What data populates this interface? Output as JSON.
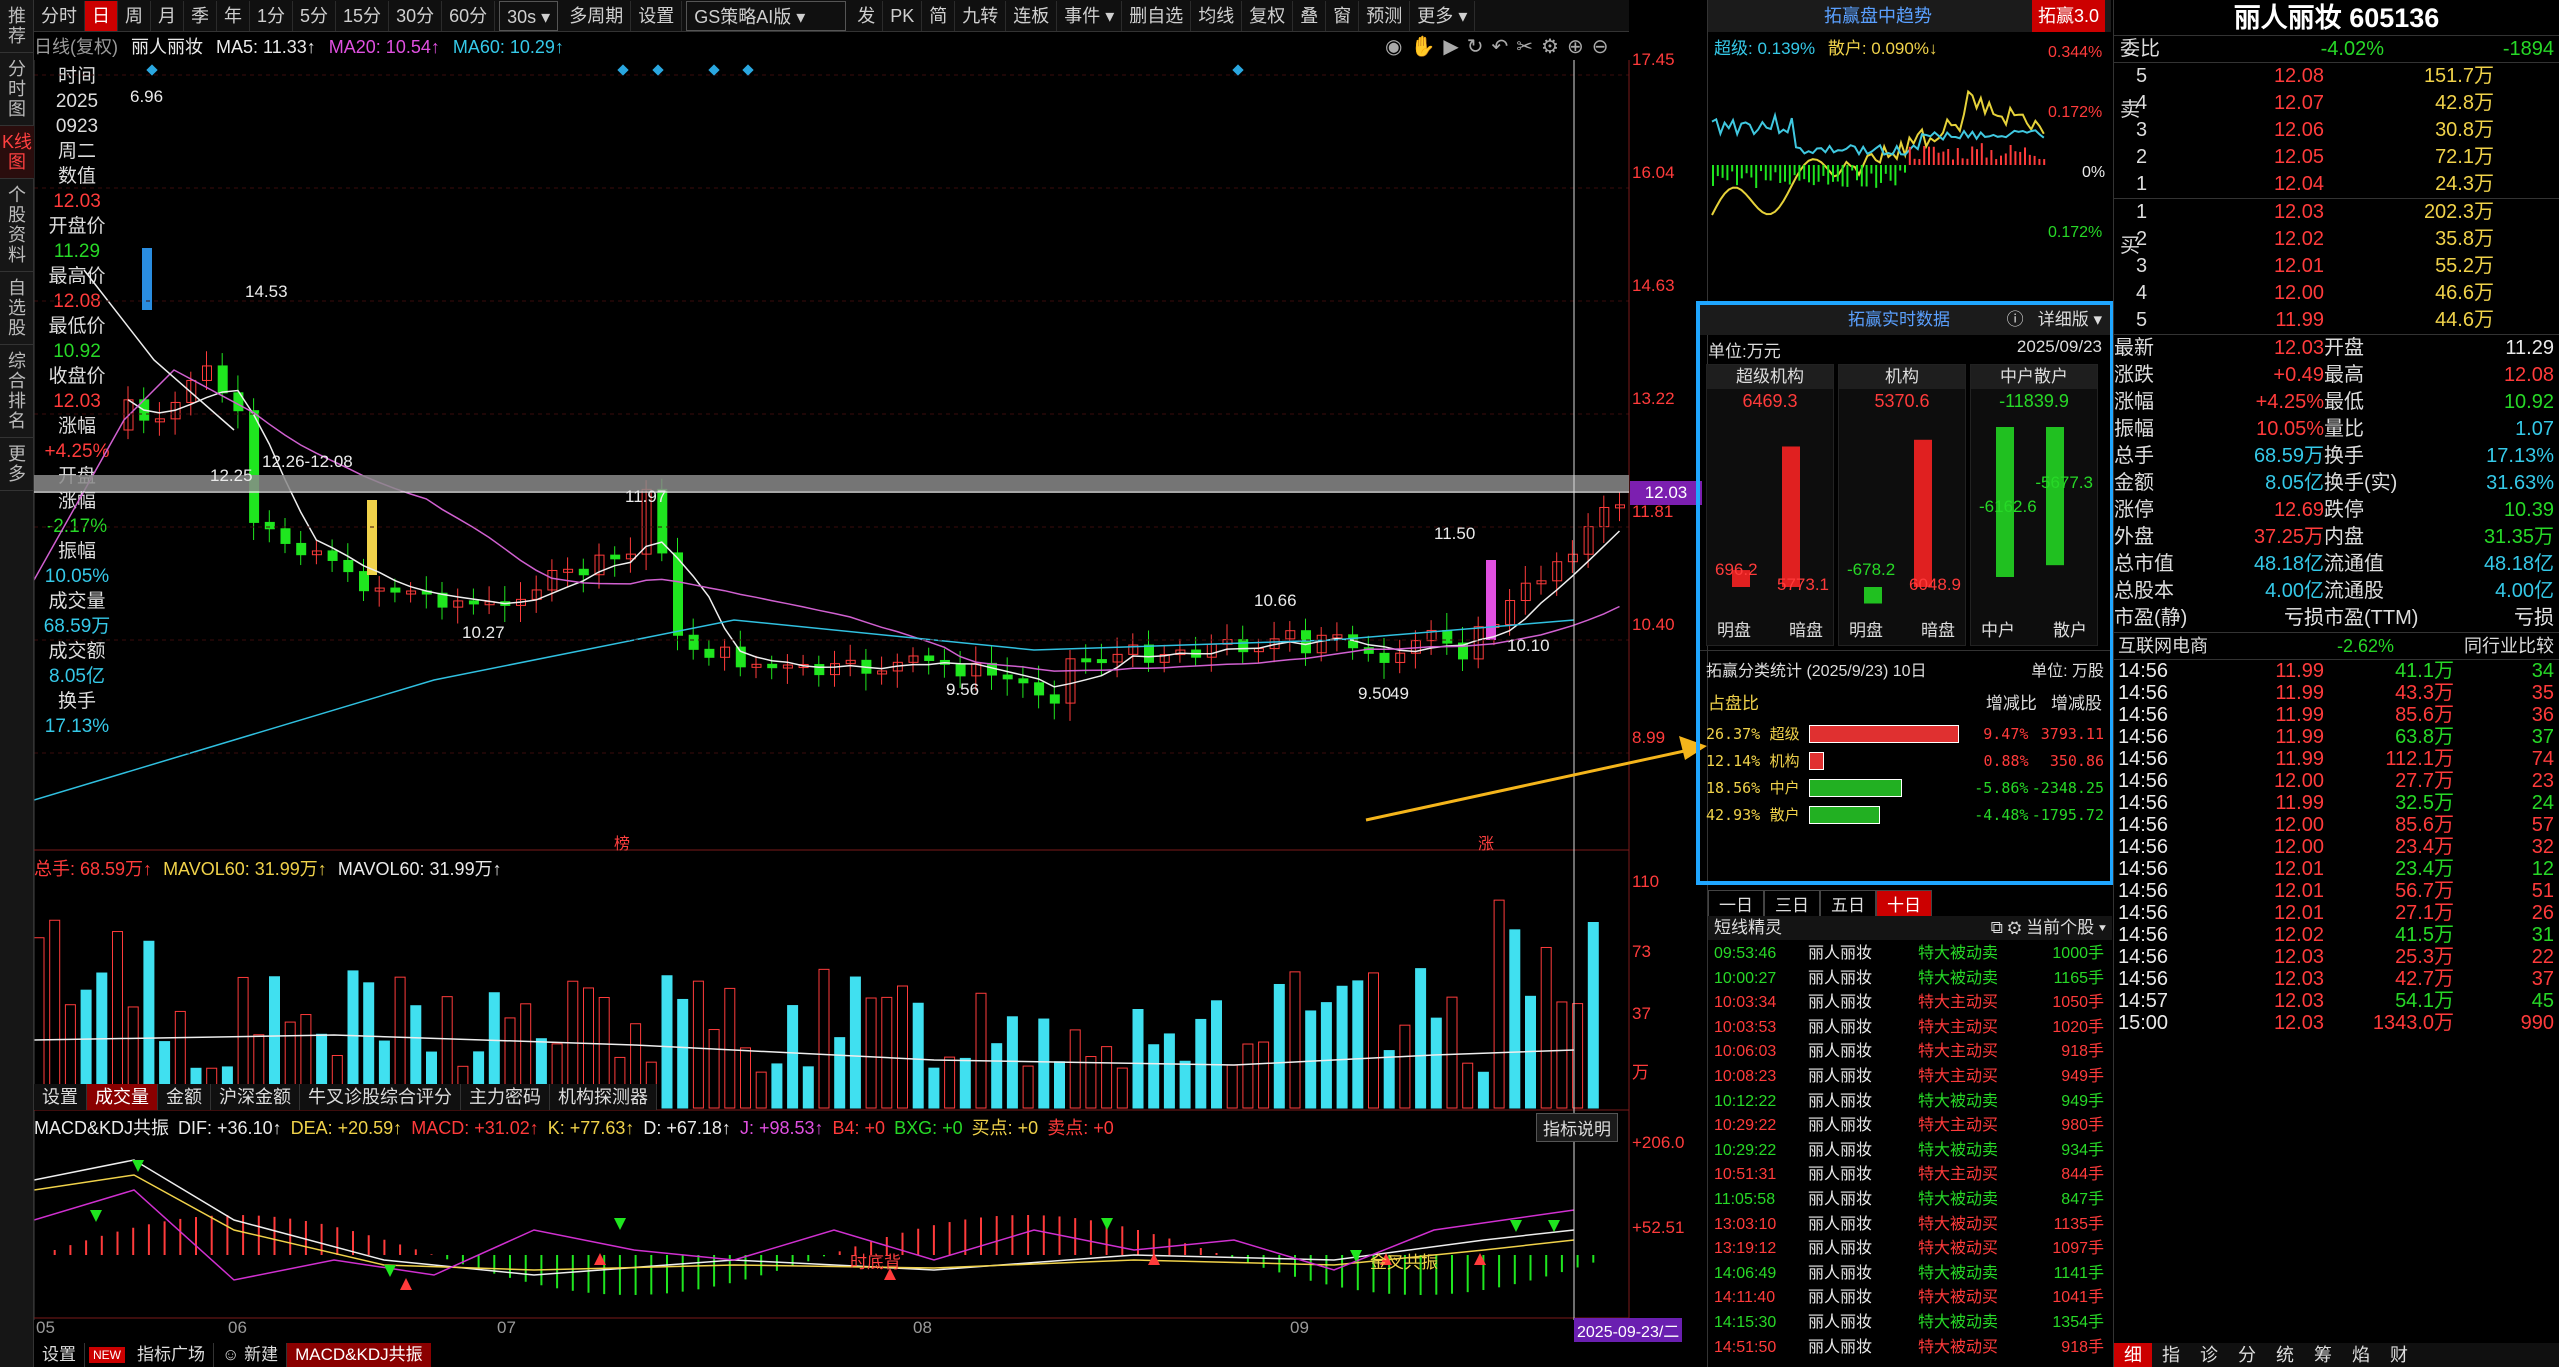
{
  "left_tabs": [
    "推荐",
    "分时图",
    "K线图",
    "个股资料",
    "自选股",
    "综合排名",
    "更多"
  ],
  "toolbar": {
    "items": [
      "分时",
      "日",
      "周",
      "月",
      "季",
      "年",
      "1分",
      "5分",
      "15分",
      "30分",
      "60分",
      "30s",
      "多周期",
      "设置"
    ],
    "dropdown": "GS策略AI版",
    "right_items": [
      "发",
      "PK",
      "简",
      "九转",
      "连板",
      "事件",
      "删自选",
      "均线",
      "复权",
      "叠",
      "窗",
      "预测",
      "更多"
    ]
  },
  "chart": {
    "title_bar": "日线(复权)",
    "stock_name": "丽人丽妆",
    "ma5": "MA5: 11.33↑",
    "ma20": "MA20: 10.54↑",
    "ma60": "MA60: 10.29↑",
    "price_axis": [
      "17.45",
      "16.04",
      "14.63",
      "13.22",
      "11.81",
      "10.40",
      "8.99"
    ],
    "current_price_tag": "12.03",
    "annotations": {
      "top_left": "6.96",
      "high": "14.53",
      "low1": "12.25",
      "range": "12.26-12.08",
      "mid_high": "11.97",
      "low2": "10.27",
      "low3": "9.56",
      "p1066": "10.66",
      "p1150": "11.50",
      "p1010": "10.10",
      "p95": "9.50",
      "p949": "49"
    },
    "markers": {
      "bang": "榜",
      "zhang": "涨"
    },
    "x_axis": [
      "05",
      "06",
      "07",
      "08",
      "09"
    ],
    "date_tag": "2025-09-23/二"
  },
  "info_panel": {
    "items": [
      {
        "label": "时间",
        "value": "2025"
      },
      {
        "label": "",
        "value": "0923"
      },
      {
        "label": "",
        "value": "周二"
      },
      {
        "label": "数值",
        "value": "12.03"
      },
      {
        "label": "开盘价",
        "value": "11.29"
      },
      {
        "label": "最高价",
        "value": "12.08"
      },
      {
        "label": "最低价",
        "value": "10.92"
      },
      {
        "label": "收盘价",
        "value": "12.03"
      },
      {
        "label": "涨幅",
        "value": "+4.25%"
      },
      {
        "label": "开盘",
        "value": ""
      },
      {
        "label": "涨幅",
        "value": "-2.17%"
      },
      {
        "label": "振幅",
        "value": "10.05%"
      },
      {
        "label": "成交量",
        "value": "68.59万"
      },
      {
        "label": "成交额",
        "value": "8.05亿"
      },
      {
        "label": "换手",
        "value": "17.13%"
      }
    ]
  },
  "volume": {
    "header_total": "总手: 68.59万↑",
    "mavol60a": "MAVOL60: 31.99万↑",
    "mavol60b": "MAVOL60: 31.99万↑",
    "axis": [
      "110",
      "73",
      "37",
      "万"
    ],
    "tabs": [
      "设置",
      "成交量",
      "金额",
      "沪深金额",
      "牛叉诊股综合评分",
      "主力密码",
      "机构探测器"
    ]
  },
  "macd": {
    "header": "MACD&KDJ共振",
    "dif": "DIF: +36.10↑",
    "dea": "DEA: +20.59↑",
    "macd": "MACD: +31.02↑",
    "k": "K: +77.63↑",
    "d": "D: +67.18↑",
    "j": "J: +98.53↑",
    "b4": "B4: +0",
    "bxg": "BXG: +0",
    "buy": "买点: +0",
    "sell": "卖点: +0",
    "explain_button": "指标说明",
    "axis": [
      "+206.0",
      "+52.51"
    ],
    "label1": "时底背",
    "label2": "金叉共振"
  },
  "bottom_tabs": [
    "设置",
    "NEW",
    "指标广场",
    "新建",
    "MACD&KDJ共振"
  ],
  "trend_panel": {
    "title": "拓赢盘中趋势",
    "badge": "拓赢3.0",
    "super": "超级: 0.139%",
    "retail": "散户: 0.090%↓",
    "axis": [
      "0.344%",
      "0.172%",
      "0%",
      "0.172%"
    ]
  },
  "realtime": {
    "title": "拓赢实时数据",
    "detail_btn": "详细版",
    "unit": "单位:万元",
    "date": "2025/09/23",
    "groups": [
      {
        "name": "超级机构",
        "total": "6469.3",
        "left_val": "696.2",
        "right_val": "5773.1",
        "left_label": "明盘",
        "right_label": "暗盘"
      },
      {
        "name": "机构",
        "total": "5370.6",
        "left_val": "-678.2",
        "right_val": "6048.9",
        "left_label": "明盘",
        "right_label": "暗盘"
      },
      {
        "name": "中户散户",
        "total": "-11839.9",
        "left_val": "-6162.6",
        "right_val": "-5677.3",
        "left_label": "中户",
        "right_label": "散户"
      }
    ],
    "stats_title": "拓赢分类统计 (2025/9/23)",
    "stats_days": "10日",
    "stats_unit": "单位: 万股",
    "stats_header": [
      "占盘比",
      "增减比",
      "增减股"
    ],
    "stats": [
      {
        "pct": "26.37%",
        "name": "超级",
        "ratio": "9.47%",
        "shares": "3793.11",
        "bar": 1.0,
        "color": "#e03030"
      },
      {
        "pct": "12.14%",
        "name": "机构",
        "ratio": "0.88%",
        "shares": "350.86",
        "bar": 0.1,
        "color": "#e03030"
      },
      {
        "pct": "18.56%",
        "name": "中户",
        "ratio": "-5.86%",
        "shares": "-2348.25",
        "bar": 0.62,
        "color": "#22b022"
      },
      {
        "pct": "42.93%",
        "name": "散户",
        "ratio": "-4.48%",
        "shares": "-1795.72",
        "bar": 0.47,
        "color": "#22b022"
      }
    ],
    "range_tabs": [
      "一日",
      "三日",
      "五日",
      "十日"
    ]
  },
  "short_line": {
    "title": "短线精灵",
    "filter": "当前个股",
    "rows": [
      [
        "09:53:46",
        "丽人丽妆",
        "特大被动卖",
        "1000手",
        "g"
      ],
      [
        "10:00:27",
        "丽人丽妆",
        "特大被动卖",
        "1165手",
        "g"
      ],
      [
        "10:03:34",
        "丽人丽妆",
        "特大主动买",
        "1050手",
        "r"
      ],
      [
        "10:03:53",
        "丽人丽妆",
        "特大主动买",
        "1020手",
        "r"
      ],
      [
        "10:06:03",
        "丽人丽妆",
        "特大主动买",
        "918手",
        "r"
      ],
      [
        "10:08:23",
        "丽人丽妆",
        "特大主动买",
        "949手",
        "r"
      ],
      [
        "10:12:22",
        "丽人丽妆",
        "特大被动卖",
        "949手",
        "g"
      ],
      [
        "10:29:22",
        "丽人丽妆",
        "特大主动买",
        "980手",
        "r"
      ],
      [
        "10:29:22",
        "丽人丽妆",
        "特大被动卖",
        "934手",
        "g"
      ],
      [
        "10:51:31",
        "丽人丽妆",
        "特大主动买",
        "844手",
        "r"
      ],
      [
        "11:05:58",
        "丽人丽妆",
        "特大被动卖",
        "847手",
        "g"
      ],
      [
        "13:03:10",
        "丽人丽妆",
        "特大被动买",
        "1135手",
        "r"
      ],
      [
        "13:19:12",
        "丽人丽妆",
        "特大被动买",
        "1097手",
        "r"
      ],
      [
        "14:06:49",
        "丽人丽妆",
        "特大被动卖",
        "1141手",
        "g"
      ],
      [
        "14:11:40",
        "丽人丽妆",
        "特大被动买",
        "1041手",
        "r"
      ],
      [
        "14:15:30",
        "丽人丽妆",
        "特大被动卖",
        "1354手",
        "g"
      ],
      [
        "14:51:50",
        "丽人丽妆",
        "特大被动买",
        "918手",
        "r"
      ]
    ]
  },
  "quote": {
    "title": "丽人丽妆  605136",
    "wb_label": "委比",
    "wb_value": "-4.02%",
    "wb_diff": "-1894",
    "sell_label": "卖",
    "buy_label": "买",
    "sells": [
      [
        "5",
        "12.08",
        "151.7万"
      ],
      [
        "4",
        "12.07",
        "42.8万"
      ],
      [
        "3",
        "12.06",
        "30.8万"
      ],
      [
        "2",
        "12.05",
        "72.1万"
      ],
      [
        "1",
        "12.04",
        "24.3万"
      ]
    ],
    "buys": [
      [
        "1",
        "12.03",
        "202.3万"
      ],
      [
        "2",
        "12.02",
        "35.8万"
      ],
      [
        "3",
        "12.01",
        "55.2万"
      ],
      [
        "4",
        "12.00",
        "46.6万"
      ],
      [
        "5",
        "11.99",
        "44.6万"
      ]
    ],
    "stats": [
      [
        "最新",
        "12.03",
        "开盘",
        "11.29"
      ],
      [
        "涨跌",
        "+0.49",
        "最高",
        "12.08"
      ],
      [
        "涨幅",
        "+4.25%",
        "最低",
        "10.92"
      ],
      [
        "振幅",
        "10.05%",
        "量比",
        "1.07"
      ],
      [
        "总手",
        "68.59万",
        "换手",
        "17.13%"
      ],
      [
        "金额",
        "8.05亿",
        "换手(实)",
        "31.63%"
      ],
      [
        "涨停",
        "12.69",
        "跌停",
        "10.39"
      ],
      [
        "外盘",
        "37.25万",
        "内盘",
        "31.35万"
      ],
      [
        "总市值",
        "48.18亿",
        "流通值",
        "48.18亿"
      ],
      [
        "总股本",
        "4.00亿",
        "流通股",
        "4.00亿"
      ],
      [
        "市盈(静)",
        "亏损",
        "市盈(TTM)",
        "亏损"
      ]
    ],
    "sector": "互联网电商",
    "sector_chg": "-2.62%",
    "sector_btn": "同行业比较",
    "ticks": [
      [
        "14:56",
        "11.99",
        "41.1万",
        "34"
      ],
      [
        "14:56",
        "11.99",
        "43.3万",
        "35"
      ],
      [
        "14:56",
        "11.99",
        "85.6万",
        "36"
      ],
      [
        "14:56",
        "11.99",
        "63.8万",
        "37"
      ],
      [
        "14:56",
        "11.99",
        "112.1万",
        "74"
      ],
      [
        "14:56",
        "12.00",
        "27.7万",
        "23"
      ],
      [
        "14:56",
        "11.99",
        "32.5万",
        "24"
      ],
      [
        "14:56",
        "12.00",
        "85.6万",
        "57"
      ],
      [
        "14:56",
        "12.00",
        "23.4万",
        "32"
      ],
      [
        "14:56",
        "12.01",
        "23.4万",
        "12"
      ],
      [
        "14:56",
        "12.01",
        "56.7万",
        "51"
      ],
      [
        "14:56",
        "12.01",
        "27.1万",
        "26"
      ],
      [
        "14:56",
        "12.02",
        "41.5万",
        "31"
      ],
      [
        "14:56",
        "12.03",
        "25.3万",
        "22"
      ],
      [
        "14:56",
        "12.03",
        "42.7万",
        "37"
      ],
      [
        "14:57",
        "12.03",
        "54.1万",
        "45"
      ],
      [
        "15:00",
        "12.03",
        "1343.0万",
        "990"
      ]
    ],
    "bottom_tabs": [
      "细",
      "指",
      "诊",
      "分",
      "统",
      "筹",
      "焰",
      "财"
    ]
  }
}
